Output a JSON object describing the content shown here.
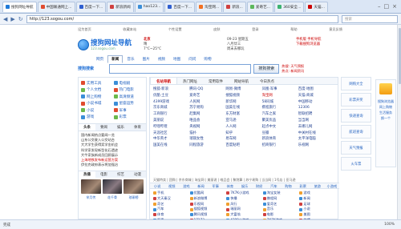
{
  "browser": {
    "tabs": [
      {
        "label": "搜狗网址导航",
        "active": true
      },
      {
        "label": "中国联通网上...",
        "active": false
      },
      {
        "label": "百度一下...",
        "active": false
      },
      {
        "label": "新浪新闻",
        "active": false
      },
      {
        "label": "hao123...",
        "active": false
      },
      {
        "label": "百度一下...",
        "active": false
      },
      {
        "label": "淘宝网...",
        "active": false
      },
      {
        "label": "新浪...",
        "active": false
      },
      {
        "label": "爱奇艺...",
        "active": false
      },
      {
        "label": "360安全...",
        "active": false
      },
      {
        "label": "天猫...",
        "active": false
      }
    ],
    "url": "http://123.sogou.com/",
    "search_placeholder": "搜索",
    "status": [
      "完成",
      "100%"
    ]
  },
  "site": {
    "topline": [
      "设为首页",
      "收藏本站",
      "个性设置",
      "皮肤",
      "登录",
      "帮助",
      "意见反馈"
    ],
    "logo_title": "搜狗网址导航",
    "logo_url": "123.sogou.com",
    "weather": {
      "city": "北京",
      "line1": "晴",
      "line2": "7°C~25°C",
      "line3": "空气质量 良"
    },
    "date": {
      "line1": "09-23 星期五",
      "line2": "八月廿三",
      "line3": "周末去哪玩"
    },
    "promo": {
      "line1": "手机版 手机导航",
      "line2": "下载搜狗浏览器"
    },
    "search_tabs": [
      "网页",
      "新闻",
      "音乐",
      "图片",
      "视频",
      "地图",
      "问问",
      "购物"
    ],
    "search_logo": "搜狗搜索",
    "search_button": "搜狗搜索",
    "search_hot": [
      "热搜: 天气预报",
      "热点: 新闻资讯"
    ],
    "quick_links": [
      "实用工具",
      "电视剧",
      "个人文档",
      "热门电影",
      "网上购物",
      "高清频道",
      "小说书城",
      "星座运势",
      "小说",
      "军事",
      "游戏",
      "彩票"
    ],
    "left_tabs": [
      "头条",
      "要闻",
      "娱乐",
      "体育"
    ],
    "news": [
      {
        "text": "国内新闻热点要闻一览",
        "red": false
      },
      {
        "text": "山东公交驶入公交站台",
        "red": false
      },
      {
        "text": "大大学生获得奖学金机会",
        "red": false
      },
      {
        "text": "科学家发现新型化石遗迹",
        "red": false
      },
      {
        "text": "大牛家族新成员回顾展示",
        "red": false
      },
      {
        "text": "上海地铁发布新运营方案",
        "red": true
      },
      {
        "text": "伊拉克政府表示将加强治",
        "red": false
      }
    ],
    "video_tabs": [
      "热播",
      "电影",
      "综艺",
      "动漫"
    ],
    "video_captions": [
      "芈月传",
      "花千骨",
      "琅琊榜"
    ],
    "center_tabs": [
      "名站导航",
      "热门网址",
      "常用软件",
      "网站导航",
      "今日热点"
    ],
    "site_grid": [
      {
        "t": "搜狐·新浪",
        "r": false
      },
      {
        "t": "腾讯·QQ",
        "r": false
      },
      {
        "t": "网易·微博",
        "r": false
      },
      {
        "t": "凤凰·军事",
        "r": false
      },
      {
        "t": "百度·地图",
        "r": false
      },
      {
        "t": "优酷·土豆",
        "r": false
      },
      {
        "t": "爱奇艺",
        "r": false
      },
      {
        "t": "搜狐视频",
        "r": false
      },
      {
        "t": "淘宝网",
        "r": true
      },
      {
        "t": "天猫·商城",
        "r": false
      },
      {
        "t": "4399游戏",
        "r": false
      },
      {
        "t": "人民网",
        "r": false
      },
      {
        "t": "新华网",
        "r": false
      },
      {
        "t": "58同城",
        "r": false
      },
      {
        "t": "中国移动",
        "r": false
      },
      {
        "t": "京东商城",
        "r": false
      },
      {
        "t": "苏宁易购",
        "r": false
      },
      {
        "t": "国美在线",
        "r": false
      },
      {
        "t": "携程旅行",
        "r": false
      },
      {
        "t": "12306",
        "r": false
      },
      {
        "t": "工商银行",
        "r": false
      },
      {
        "t": "赶集网",
        "r": false
      },
      {
        "t": "东方财富",
        "r": false
      },
      {
        "t": "汽车之家",
        "r": false
      },
      {
        "t": "智联招聘",
        "r": false
      },
      {
        "t": "美丽说",
        "r": false
      },
      {
        "t": "唯品会",
        "r": false
      },
      {
        "t": "亚马逊",
        "r": false
      },
      {
        "t": "聚美优品",
        "r": false
      },
      {
        "t": "当当网",
        "r": false
      },
      {
        "t": "哔哩哔哩",
        "r": false
      },
      {
        "t": "央视网",
        "r": false
      },
      {
        "t": "人人网",
        "r": false
      },
      {
        "t": "起点中文",
        "r": false
      },
      {
        "t": "去哪儿网",
        "r": false
      },
      {
        "t": "天涯社区",
        "r": false
      },
      {
        "t": "猫扑",
        "r": false
      },
      {
        "t": "知乎",
        "r": false
      },
      {
        "t": "豆瓣",
        "r": false
      },
      {
        "t": "中关村在线",
        "r": false
      },
      {
        "t": "中华英才",
        "r": false
      },
      {
        "t": "瑞丽女性",
        "r": false
      },
      {
        "t": "易车网",
        "r": false
      },
      {
        "t": "新浪体育",
        "r": false
      },
      {
        "t": "太平洋电脑",
        "r": false
      },
      {
        "t": "国美在线",
        "r": false
      },
      {
        "t": "同程旅游",
        "r": false
      },
      {
        "t": "百度贴吧",
        "r": false
      },
      {
        "t": "招商银行",
        "r": false
      },
      {
        "t": "乐视网",
        "r": false
      }
    ],
    "link_row": "天猫特卖 | 团购 | 京东商城 | 淘宝网 | 美丽说 | 唯品会 | 聚划算 | 苏宁易购 | 当当网 | 1号店 | 亚马逊",
    "cat_row": [
      "小说",
      "视频",
      "游戏",
      "新闻",
      "军事",
      "体育",
      "娱乐",
      "财经",
      "汽车",
      "购物",
      "彩票",
      "旅游",
      "小游戏"
    ],
    "sites2": [
      "手机",
      "优酷网",
      "7K7K小游戏",
      "淘宝女装",
      "游戏",
      "大天秦汉",
      "新浪微博",
      "快播",
      "携程网",
      "新闻",
      "奇艺",
      "乐视网",
      "风行",
      "爱奇艺",
      "足球",
      "汽车",
      "搜狐视频",
      "瑞丽网",
      "音乐",
      "小说",
      "体育",
      "腾讯视频",
      "大富翁",
      "电影",
      "美图",
      "军事",
      "17173",
      "4399小游戏",
      "7K7K游戏",
      "微博",
      "星座",
      "网易邮箱",
      "腾讯游戏",
      "驱动精灵",
      "淘宝"
    ],
    "right_boxes": [
      "网购大全",
      "彩票开奖",
      "快递查询",
      "航班查询",
      "天气预报",
      "火车票"
    ],
    "ad": [
      "搜狗浏览器",
      "网上购物",
      "生活服务",
      "换一个"
    ]
  }
}
